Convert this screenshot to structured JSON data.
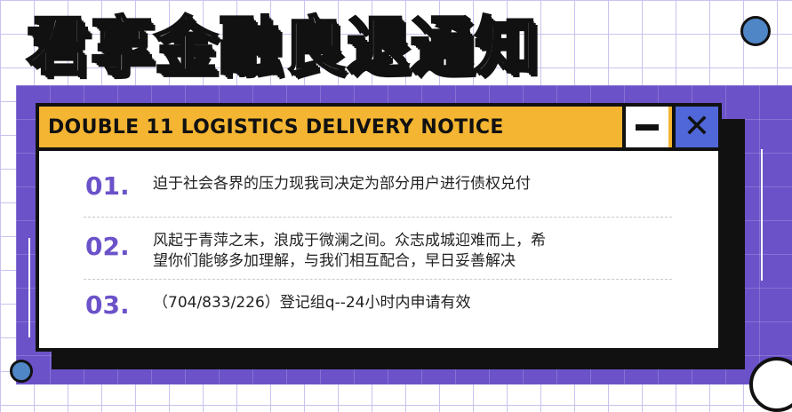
{
  "title": "君享金融良退通知",
  "header": {
    "title": "DOUBLE 11 LOGISTICS DELIVERY NOTICE"
  },
  "items": [
    {
      "num": "01.",
      "text": "迫于社会各界的压力现我司决定为部分用户进行债权兑付"
    },
    {
      "num": "02.",
      "line1": "风起于青萍之末，浪成于微澜之间。众志成城迎难而上，希",
      "line2": "望你们能够多加理解，与我们相互配合，早日妥善解决"
    },
    {
      "num": "03.",
      "text": "（704/833/226）登记组q--24小时内申请有效"
    }
  ],
  "colors": {
    "purple": "#6b52c9",
    "yellow": "#f4b532",
    "blue": "#4f67d8",
    "circle_blue": "#4f86c6"
  },
  "icons": {
    "minimize": "minimize-icon",
    "close": "close-icon"
  }
}
